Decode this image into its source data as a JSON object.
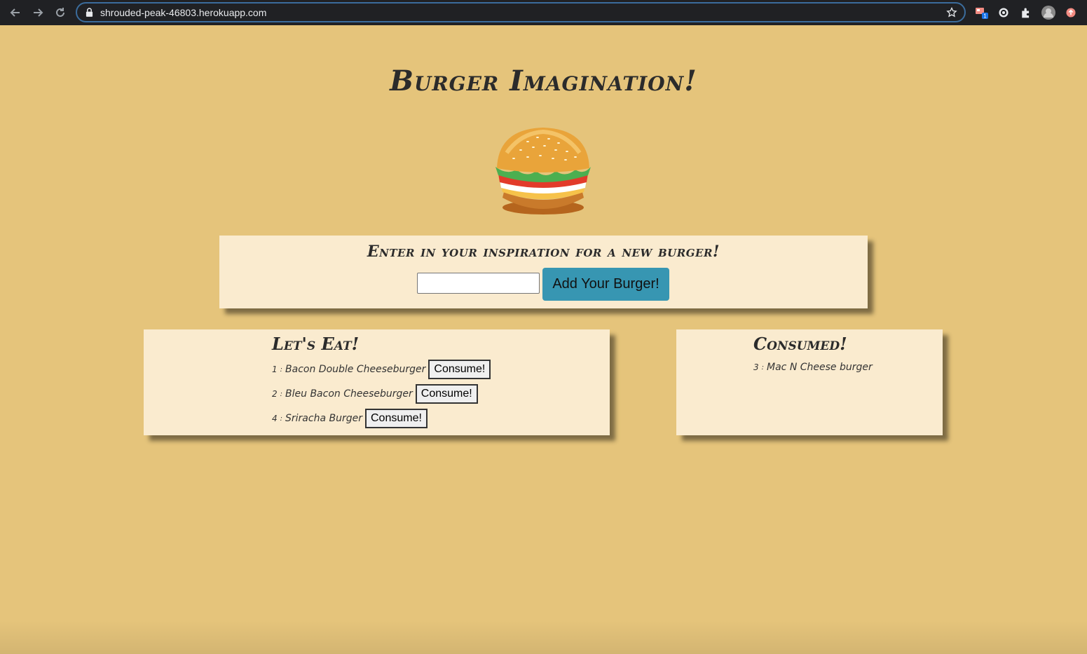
{
  "browser": {
    "url": "shrouded-peak-46803.herokuapp.com",
    "extension_badge": "1"
  },
  "page": {
    "title": "Burger Imagination!",
    "form": {
      "heading": "Enter in your inspiration for a new burger!",
      "input_value": "",
      "button_label": "Add Your Burger!"
    },
    "eat": {
      "heading": "Let's Eat!",
      "items": [
        {
          "id": "1",
          "name": "Bacon Double Cheeseburger",
          "button": "Consume!"
        },
        {
          "id": "2",
          "name": "Bleu Bacon Cheeseburger",
          "button": "Consume!"
        },
        {
          "id": "4",
          "name": "Sriracha Burger",
          "button": "Consume!"
        }
      ]
    },
    "consumed": {
      "heading": "Consumed!",
      "items": [
        {
          "id": "3",
          "name": "Mac N Cheese burger"
        }
      ]
    }
  },
  "colors": {
    "background": "#e5c47b",
    "panel": "#faebcf",
    "button_accent": "#3796b2"
  }
}
